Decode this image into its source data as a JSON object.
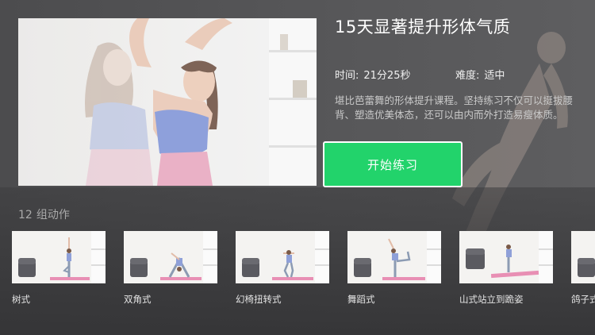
{
  "course": {
    "title": "15天显著提升形体气质",
    "time_label": "时间:",
    "time_value": "21分25秒",
    "level_label": "难度:",
    "level_value": "适中",
    "description": "堪比芭蕾舞的形体提升课程。坚持练习不仅可以挺拔腰背、塑造优美体态，还可以由内而外打造易瘦体质。",
    "start_button": "开始练习"
  },
  "actions_section": {
    "count": "12",
    "label": "组动作"
  },
  "actions": [
    {
      "label": "树式",
      "icon": "tree-pose-thumbnail"
    },
    {
      "label": "双角式",
      "icon": "double-angle-pose-thumbnail"
    },
    {
      "label": "幻椅扭转式",
      "icon": "chair-twist-pose-thumbnail"
    },
    {
      "label": "舞蹈式",
      "icon": "dancer-pose-thumbnail"
    },
    {
      "label": "山式站立到跪姿",
      "icon": "mountain-to-kneel-thumbnail"
    },
    {
      "label": "鸽子式",
      "icon": "pigeon-pose-thumbnail"
    }
  ],
  "colors": {
    "accent": "#22d36b",
    "background": "#4f4f51",
    "mat": "#e88fb4",
    "sofa": "#5a5a60"
  }
}
